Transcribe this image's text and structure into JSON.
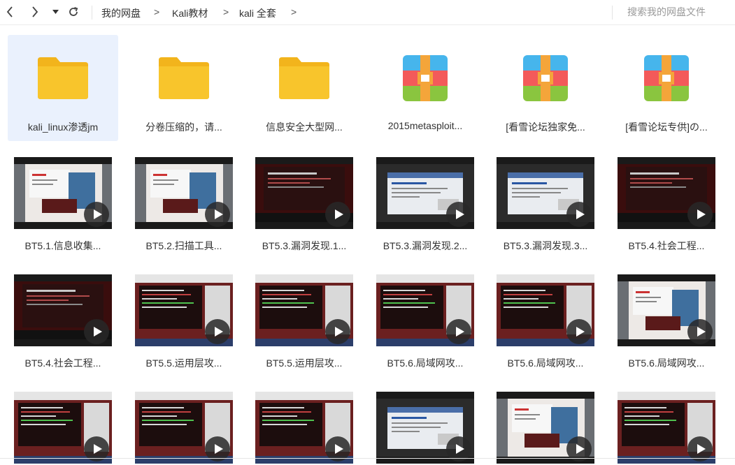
{
  "nav": {
    "back_icon": "chevron-left-icon",
    "forward_icon": "chevron-right-icon",
    "history_icon": "caret-down-icon",
    "refresh_icon": "refresh-icon",
    "breadcrumb": [
      "我的网盘",
      "Kali教材",
      "kali 全套"
    ],
    "separator": ">"
  },
  "search": {
    "placeholder": "搜索我的网盘文件"
  },
  "folders": [
    {
      "name": "kali_linux渗透jm",
      "type": "folder",
      "selected": true
    },
    {
      "name": "分卷压缩的，请...",
      "type": "folder"
    },
    {
      "name": "信息安全大型网...",
      "type": "folder"
    },
    {
      "name": "2015metasploit...",
      "type": "archive"
    },
    {
      "name": "[看雪论坛独家免...",
      "type": "archive"
    },
    {
      "name": "[看雪论坛专供]の...",
      "type": "archive"
    }
  ],
  "videos_row1": [
    {
      "name": "BT5.1.信息收集...",
      "theme": "doc"
    },
    {
      "name": "BT5.2.扫描工具...",
      "theme": "doc"
    },
    {
      "name": "BT5.3.漏洞发现.1...",
      "theme": "dark"
    },
    {
      "name": "BT5.3.漏洞发现.2...",
      "theme": "web"
    },
    {
      "name": "BT5.3.漏洞发现.3...",
      "theme": "web"
    },
    {
      "name": "BT5.4.社会工程...",
      "theme": "dark"
    }
  ],
  "videos_row2": [
    {
      "name": "BT5.4.社会工程...",
      "theme": "dark"
    },
    {
      "name": "BT5.5.运用层攻...",
      "theme": "terminal"
    },
    {
      "name": "BT5.5.运用层攻...",
      "theme": "terminal"
    },
    {
      "name": "BT5.6.局域网攻...",
      "theme": "terminal"
    },
    {
      "name": "BT5.6.局域网攻...",
      "theme": "terminal"
    },
    {
      "name": "BT5.6.局域网攻...",
      "theme": "doc"
    }
  ],
  "videos_row3": [
    {
      "name": "",
      "theme": "terminal"
    },
    {
      "name": "",
      "theme": "terminal"
    },
    {
      "name": "",
      "theme": "terminal"
    },
    {
      "name": "",
      "theme": "web"
    },
    {
      "name": "",
      "theme": "doc"
    },
    {
      "name": "",
      "theme": "terminal"
    }
  ],
  "colors": {
    "folder": "#f8c52c",
    "folder_tab": "#f2b41c",
    "selected_bg": "#eaf1fd",
    "archive_blue": "#46b5ec",
    "archive_red": "#f35a5a",
    "archive_green": "#8ac53f",
    "archive_strap": "#f4a53a"
  }
}
